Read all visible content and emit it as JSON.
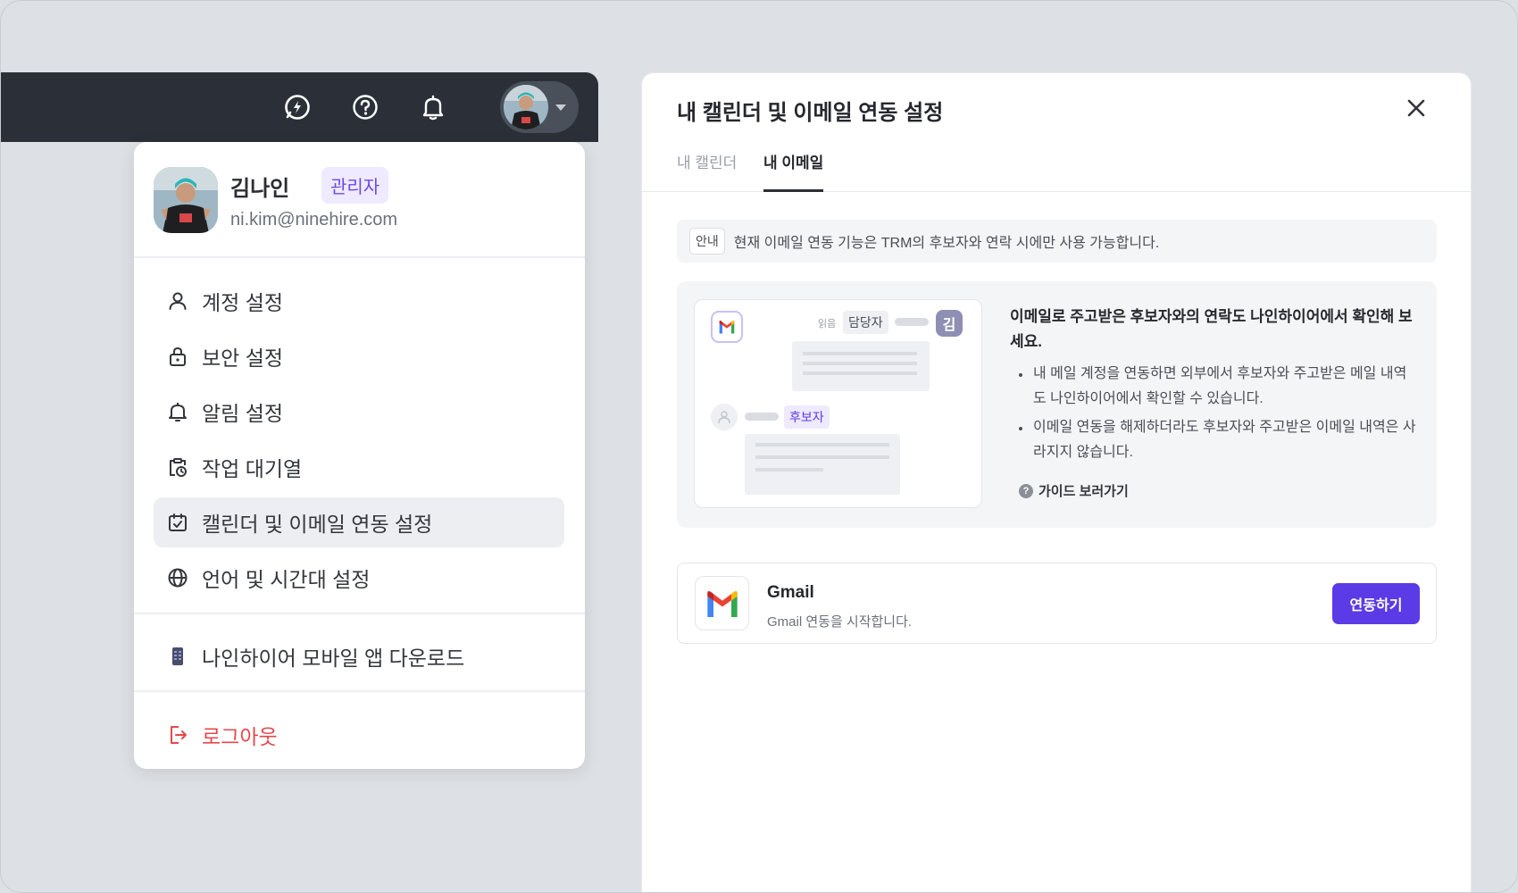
{
  "topbar": {
    "icons": [
      "chat-icon",
      "help-icon",
      "bell-icon"
    ]
  },
  "user_menu": {
    "name": "김나인",
    "role": "관리자",
    "email": "ni.kim@ninehire.com",
    "items": [
      {
        "label": "계정 설정",
        "icon": "person-icon"
      },
      {
        "label": "보안 설정",
        "icon": "lock-icon"
      },
      {
        "label": "알림 설정",
        "icon": "bell-icon"
      },
      {
        "label": "작업 대기열",
        "icon": "clipboard-clock-icon"
      },
      {
        "label": "캘린더 및 이메일 연동 설정",
        "icon": "calendar-check-icon",
        "active": true
      },
      {
        "label": "언어 및 시간대 설정",
        "icon": "globe-icon"
      }
    ],
    "app_download": "나인하이어 모바일 앱 다운로드",
    "logout": "로그아웃"
  },
  "panel": {
    "title": "내 캘린더 및 이메일 연동 설정",
    "tabs": [
      {
        "label": "내 캘린더",
        "active": false
      },
      {
        "label": "내 이메일",
        "active": true
      }
    ],
    "notice": {
      "tag": "안내",
      "text": "현재 이메일 연동 기능은 TRM의 후보자와 연락 시에만 사용 가능합니다."
    },
    "illustration": {
      "read_label": "읽음",
      "manager_label": "담당자",
      "manager_initial": "김",
      "candidate_label": "후보자"
    },
    "info": {
      "title": "이메일로 주고받은 후보자와의 연락도 나인하이어에서 확인해 보세요.",
      "bullets": [
        "내 메일 계정을 연동하면 외부에서 후보자와 주고받은 메일 내역도 나인하이어에서 확인할 수 있습니다.",
        "이메일 연동을 해제하더라도 후보자와 주고받은 이메일 내역은 사라지지 않습니다."
      ],
      "guide_link": "가이드 보러가기"
    },
    "gmail": {
      "name": "Gmail",
      "description": "Gmail 연동을 시작합니다.",
      "button": "연동하기"
    }
  },
  "colors": {
    "accent": "#5b3be6",
    "topbar": "#2b3038",
    "logout": "#e5484d",
    "role_badge_bg": "#efeaff"
  }
}
